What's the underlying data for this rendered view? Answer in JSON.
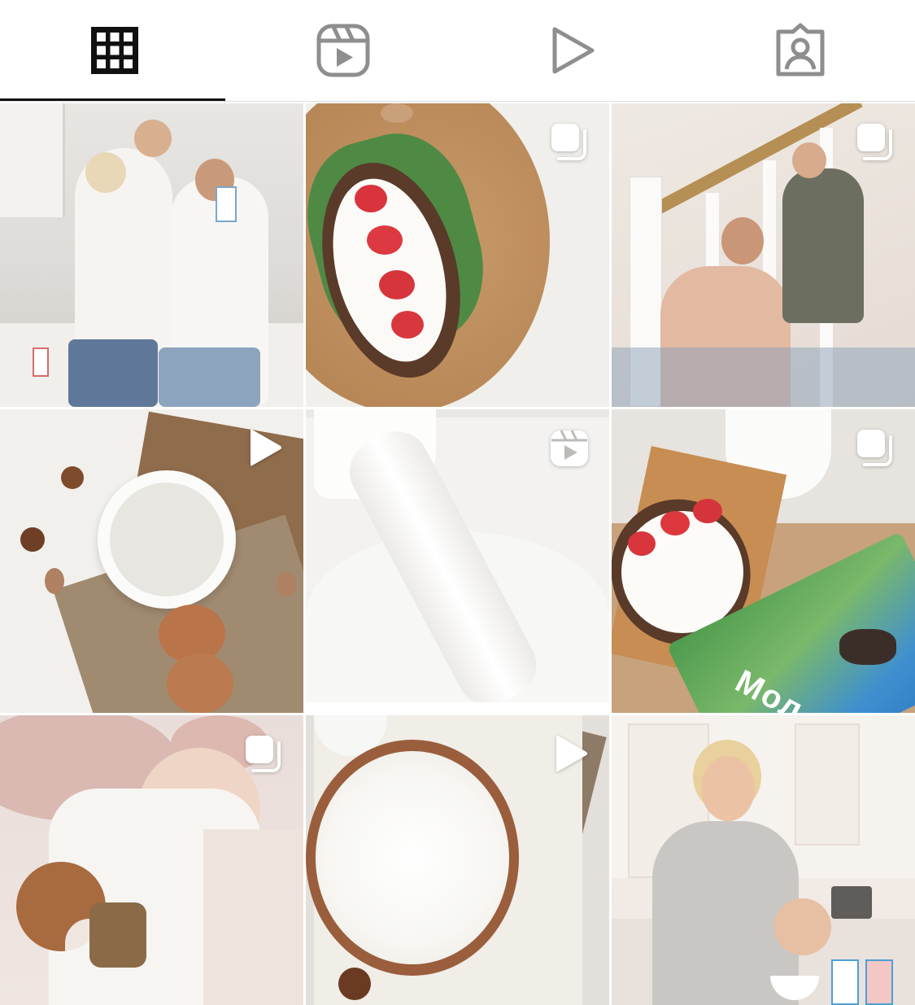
{
  "tabs": [
    {
      "name": "grid",
      "icon": "grid-icon",
      "active": true
    },
    {
      "name": "reels",
      "icon": "reels-icon",
      "active": false
    },
    {
      "name": "videos",
      "icon": "play-icon",
      "active": false
    },
    {
      "name": "tagged",
      "icon": "tagged-person-icon",
      "active": false
    }
  ],
  "colors": {
    "icon_active": "#111111",
    "icon_inactive": "#8e8e8e",
    "divider": "#dbdbdb",
    "badge": "#ffffff"
  },
  "posts": [
    {
      "id": "post-1",
      "badge": "none",
      "scene": "family-kitchen"
    },
    {
      "id": "post-2",
      "badge": "carousel-icon",
      "scene": "strawberry-toast"
    },
    {
      "id": "post-3",
      "badge": "carousel-icon",
      "scene": "staircase-family"
    },
    {
      "id": "post-4",
      "badge": "play-icon",
      "scene": "milk-bowl-nuts"
    },
    {
      "id": "post-5",
      "badge": "reels-icon",
      "scene": "milk-pour"
    },
    {
      "id": "post-6",
      "badge": "carousel-icon",
      "scene": "toast-milk-pack"
    },
    {
      "id": "post-7",
      "badge": "carousel-icon",
      "scene": "child-cookies"
    },
    {
      "id": "post-8",
      "badge": "play-icon",
      "scene": "cottage-cheese"
    },
    {
      "id": "post-9",
      "badge": "none",
      "scene": "mother-daughter-kitchen"
    }
  ],
  "visible_text": {
    "milk_pack_label": "Мол"
  }
}
